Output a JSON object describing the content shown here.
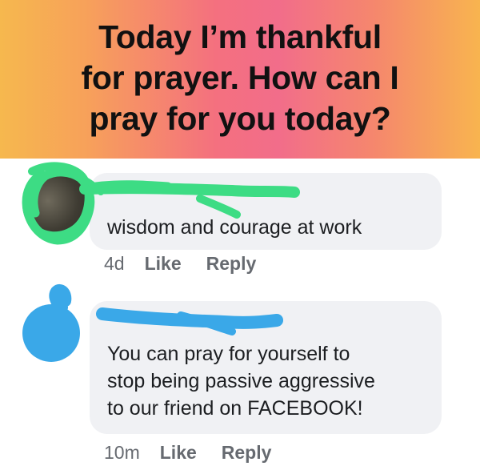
{
  "post": {
    "banner_lines": [
      "Today I’m thankful",
      "for prayer. How can I",
      "pray for you today?"
    ],
    "banner_colors": [
      "#f6b84e",
      "#f4707f",
      "#f8b44f"
    ]
  },
  "comments": [
    {
      "text_lines": [
        "wisdom and courage at work"
      ],
      "time": "4d",
      "like_label": "Like",
      "reply_label": "Reply",
      "redaction_color": "#3ddc84"
    },
    {
      "text_lines": [
        "You can pray for yourself to",
        "stop being passive aggressive",
        "to our friend on FACEBOOK!"
      ],
      "time": "10m",
      "like_label": "Like",
      "reply_label": "Reply",
      "redaction_color": "#3aa8e8"
    }
  ]
}
